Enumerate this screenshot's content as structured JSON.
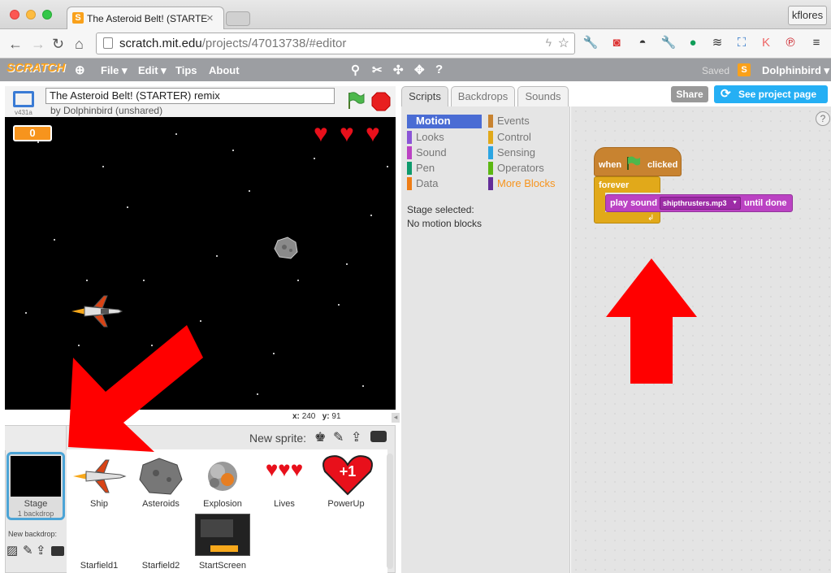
{
  "browser": {
    "tab_title": "The Asteroid Belt! (STARTE",
    "user": "kflores",
    "url_host": "scratch.mit.edu",
    "url_path": "/projects/47013738/#editor"
  },
  "menu": {
    "logo": "SCRATCH",
    "file": "File ▾",
    "edit": "Edit ▾",
    "tips": "Tips",
    "about": "About",
    "saved": "Saved",
    "username": "Dolphinbird ▾"
  },
  "stage": {
    "version": "v431a",
    "title": "The Asteroid Belt! (STARTER) remix",
    "byline": "by Dolphinbird (unshared)",
    "score": "0",
    "x_label": "x:",
    "x_value": "240",
    "y_label": "y:",
    "y_value": "91"
  },
  "sprites": {
    "new_sprite_label": "New sprite:",
    "stage_label": "Stage",
    "stage_sub": "1 backdrop",
    "new_backdrop_label": "New backdrop:",
    "items": [
      {
        "name": "Ship"
      },
      {
        "name": "Asteroids"
      },
      {
        "name": "Explosion"
      },
      {
        "name": "Lives"
      },
      {
        "name": "PowerUp"
      },
      {
        "name": "Starfield1"
      },
      {
        "name": "Starfield2"
      },
      {
        "name": "StartScreen"
      }
    ]
  },
  "tabs": {
    "scripts": "Scripts",
    "backdrops": "Backdrops",
    "sounds": "Sounds"
  },
  "buttons": {
    "share": "Share",
    "see_project": "See project page"
  },
  "palette": {
    "categories": [
      {
        "label": "Motion",
        "color": "#4a6cd4"
      },
      {
        "label": "Looks",
        "color": "#8a55d7"
      },
      {
        "label": "Sound",
        "color": "#bb42c3"
      },
      {
        "label": "Pen",
        "color": "#0e9a6c"
      },
      {
        "label": "Data",
        "color": "#ee7d16"
      },
      {
        "label": "Events",
        "color": "#c88330"
      },
      {
        "label": "Control",
        "color": "#e1a91a"
      },
      {
        "label": "Sensing",
        "color": "#2ca5e2"
      },
      {
        "label": "Operators",
        "color": "#5cb712"
      },
      {
        "label": "More Blocks",
        "color": "#632d99"
      }
    ],
    "info_line1": "Stage selected:",
    "info_line2": "No motion blocks"
  },
  "script": {
    "when": "when",
    "clicked": "clicked",
    "forever": "forever",
    "play_sound": "play sound",
    "sound_name": "shipthrusters.mp3",
    "until_done": "until done"
  },
  "colors": {
    "events": "#c88330",
    "control": "#e1a91a",
    "sound": "#bb42c3",
    "selected_blue": "#4a6cd4",
    "arrow_red": "#ff0000"
  }
}
